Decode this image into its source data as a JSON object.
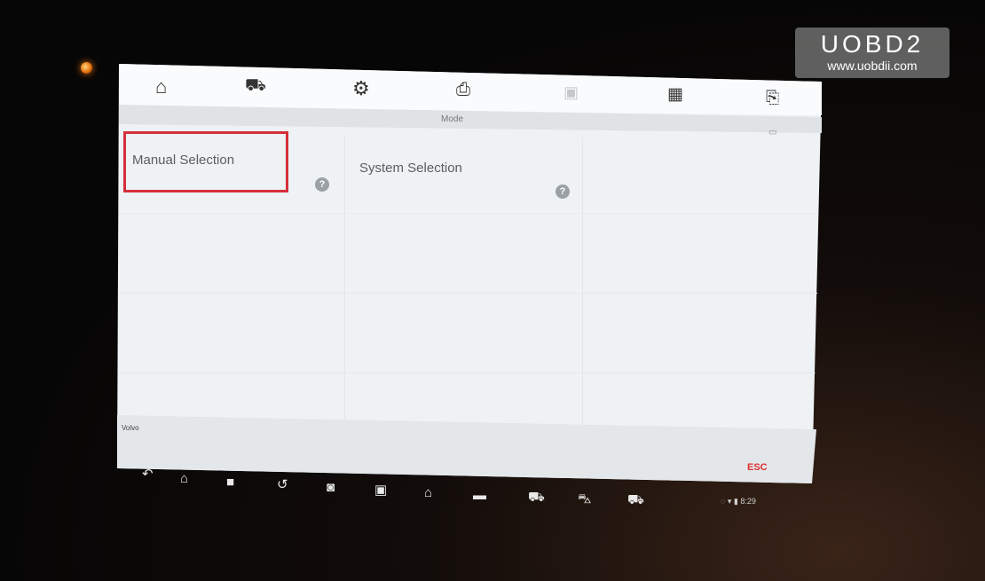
{
  "watermark": {
    "brand": "UOBD2",
    "url": "www.uobdii.com"
  },
  "toolbar": {
    "icons": [
      "home-icon",
      "vehicle-swap-icon",
      "settings-icon",
      "print-icon",
      "save-icon",
      "calendar-icon",
      "report-icon"
    ]
  },
  "header": {
    "mode_title": "Mode"
  },
  "main": {
    "options": [
      {
        "label": "Manual Selection",
        "highlighted": true
      },
      {
        "label": "System Selection",
        "highlighted": false
      }
    ],
    "help_glyph": "?"
  },
  "footer": {
    "vehicle_name": "Volvo",
    "esc_label": "ESC"
  },
  "android_nav": {
    "icons": [
      "back-icon",
      "home-icon",
      "camera-icon",
      "screen-record-icon",
      "screenshot-icon",
      "gallery-icon",
      "home-icon",
      "vci-icon",
      "vehicle-icon",
      "car-icon",
      "scan-icon"
    ]
  },
  "status_bar": {
    "time": "8:29"
  },
  "colors": {
    "highlight": "#d5303a",
    "esc": "#dd3333",
    "screen": "#eef2f4"
  }
}
